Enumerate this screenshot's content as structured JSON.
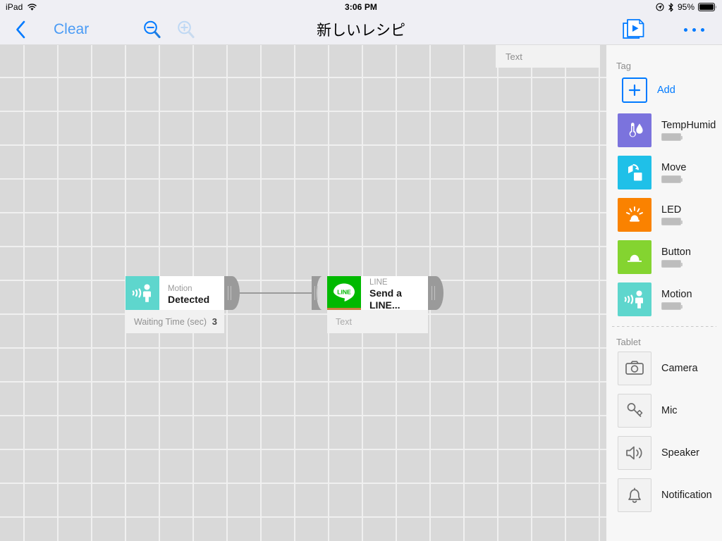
{
  "status_bar": {
    "device": "iPad",
    "wifi_icon": "wifi-icon",
    "time": "3:06 PM",
    "location_icon": "location-services-icon",
    "bluetooth_icon": "bluetooth-icon",
    "battery_percent": "95%",
    "battery_icon": "battery-icon"
  },
  "nav_bar": {
    "back_icon": "chevron-left-icon",
    "clear_label": "Clear",
    "zoom_out_icon": "magnifier-minus-icon",
    "zoom_in_icon": "magnifier-plus-icon",
    "title": "新しいレシピ",
    "play_recipe_icon": "pages-play-icon",
    "more_icon": "ellipsis-icon"
  },
  "canvas": {
    "floating_text_chip": "Text",
    "blocks": [
      {
        "id": "motion-block",
        "category": "Motion",
        "action": "Detected",
        "icon": "motion-sensor-icon",
        "icon_bg": "#5ed6cd",
        "param_name": "Waiting Time (sec)",
        "param_value": "3",
        "has_left_socket": false,
        "has_right_plug": true
      },
      {
        "id": "line-block",
        "category": "LINE",
        "action": "Send a LINE...",
        "icon": "line-messenger-icon",
        "icon_bg": "#00b900",
        "accent": "#c8803f",
        "param_name": "Text",
        "param_value": "",
        "has_left_socket": true,
        "has_right_plug": true
      }
    ]
  },
  "sidebar": {
    "tag_section": {
      "title": "Tag",
      "add_label": "Add",
      "add_icon": "plus-square-icon",
      "items": [
        {
          "label": "TempHumid",
          "icon": "thermometer-humidity-icon",
          "color": "#7b73dd",
          "battery_icon": "mini-battery-icon"
        },
        {
          "label": "Move",
          "icon": "move-box-icon",
          "color": "#1fc0e8",
          "battery_icon": "mini-battery-icon"
        },
        {
          "label": "LED",
          "icon": "led-lamp-icon",
          "color": "#fa8200",
          "battery_icon": "mini-battery-icon"
        },
        {
          "label": "Button",
          "icon": "button-icon",
          "color": "#84d430",
          "battery_icon": "mini-battery-icon"
        },
        {
          "label": "Motion",
          "icon": "motion-sensor-icon",
          "color": "#5ed6cd",
          "battery_icon": "mini-battery-icon"
        }
      ]
    },
    "tablet_section": {
      "title": "Tablet",
      "items": [
        {
          "label": "Camera",
          "icon": "camera-icon"
        },
        {
          "label": "Mic",
          "icon": "microphone-icon"
        },
        {
          "label": "Speaker",
          "icon": "speaker-icon"
        },
        {
          "label": "Notification",
          "icon": "bell-icon"
        }
      ]
    }
  },
  "colors": {
    "accent_blue": "#007aff",
    "canvas_bg": "#d9d9d9",
    "grid_line": "#f0f0f0",
    "sidebar_bg": "#f7f7f7"
  }
}
